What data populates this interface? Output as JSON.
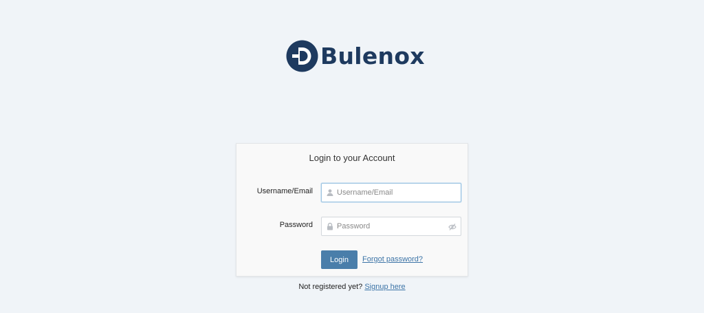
{
  "brand": {
    "name": "Bulenox",
    "color": "#1e3a5f"
  },
  "login_card": {
    "title": "Login to your Account",
    "username": {
      "label": "Username/Email",
      "placeholder": "Username/Email",
      "value": ""
    },
    "password": {
      "label": "Password",
      "placeholder": "Password",
      "value": ""
    },
    "login_button": "Login",
    "forgot_link": "Forgot password?"
  },
  "signup": {
    "prompt": "Not registered yet?",
    "link": "Signup here"
  },
  "colors": {
    "primary_button": "#4a7eaa",
    "link": "#3b73a6",
    "background": "#f0f4f8"
  },
  "icons": {
    "username": "user-icon",
    "password": "lock-icon",
    "toggle": "eye-slash-icon"
  }
}
